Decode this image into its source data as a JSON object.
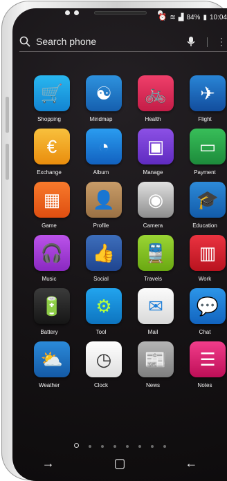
{
  "status_bar": {
    "battery": "84%",
    "time": "10:04",
    "icons": [
      "alarm-icon",
      "wifi-icon",
      "signal-icon",
      "battery-icon"
    ]
  },
  "search": {
    "placeholder": "Search phone",
    "icons": [
      "search-icon",
      "mic-icon",
      "more-vert-icon"
    ]
  },
  "apps": [
    {
      "label": "Shopping",
      "icon": "shopping-cart-icon",
      "color": "#20a8e8"
    },
    {
      "label": "Mindmap",
      "icon": "mindmap-head-icon",
      "color": "#1f79c5"
    },
    {
      "label": "Health",
      "icon": "bicycle-icon",
      "color": "#e02a58"
    },
    {
      "label": "Flight",
      "icon": "airplane-icon",
      "color": "#1e6fc0"
    },
    {
      "label": "Exchange",
      "icon": "currency-exchange-icon",
      "color": "#f1a620"
    },
    {
      "label": "Album",
      "icon": "album-photo-icon",
      "color": "#1d8ae3"
    },
    {
      "label": "Manage",
      "icon": "manage-box-icon",
      "color": "#7a3bd7"
    },
    {
      "label": "Payment",
      "icon": "bank-card-icon",
      "color": "#2aa84a"
    },
    {
      "label": "Game",
      "icon": "blocks-game-icon",
      "color": "#f0621b"
    },
    {
      "label": "Profile",
      "icon": "profile-person-icon",
      "color": "#b58a57"
    },
    {
      "label": "Camera",
      "icon": "camera-lens-icon",
      "color": "#bfbfbf"
    },
    {
      "label": "Education",
      "icon": "graduation-cap-icon",
      "color": "#1a74c4"
    },
    {
      "label": "Music",
      "icon": "headphones-icon",
      "color": "#a73ed6"
    },
    {
      "label": "Social",
      "icon": "thumbs-up-icon",
      "color": "#2b5aa8"
    },
    {
      "label": "Travels",
      "icon": "train-icon",
      "color": "#87c71e"
    },
    {
      "label": "Work",
      "icon": "binders-icon",
      "color": "#db2231"
    },
    {
      "label": "Battery",
      "icon": "battery-charging-icon",
      "color": "#2a2a2a"
    },
    {
      "label": "Tool",
      "icon": "gears-icon",
      "color": "#168fd8"
    },
    {
      "label": "Mail",
      "icon": "envelope-icon",
      "color": "#f0f0f0"
    },
    {
      "label": "Chat",
      "icon": "speech-bubble-icon",
      "color": "#1d7ed8"
    },
    {
      "label": "Weather",
      "icon": "sun-cloud-icon",
      "color": "#1d76c8"
    },
    {
      "label": "Clock",
      "icon": "clock-face-icon",
      "color": "#f7f7f7"
    },
    {
      "label": "News",
      "icon": "newspaper-icon",
      "color": "#9d9d9d"
    },
    {
      "label": "Notes",
      "icon": "notebook-icon",
      "color": "#e0196e"
    }
  ],
  "pager": {
    "count": 8,
    "active": 0
  },
  "navbar": {
    "icons": [
      "recent-apps-icon",
      "home-icon",
      "back-icon"
    ]
  }
}
